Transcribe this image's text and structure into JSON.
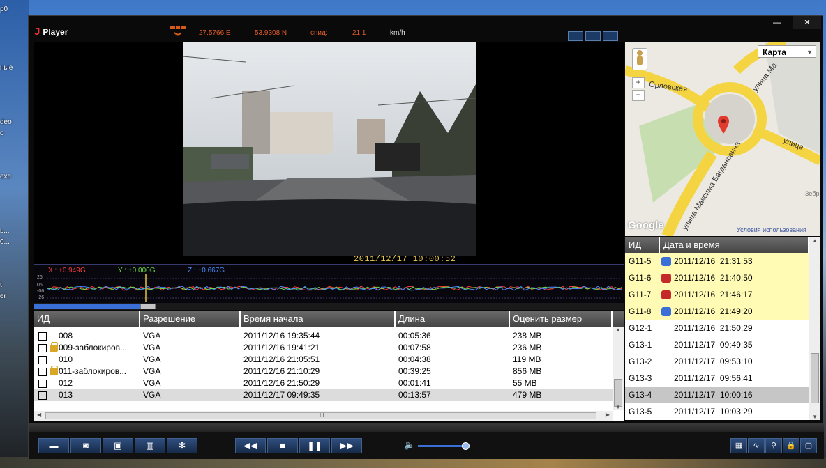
{
  "desktop": {
    "fragments": [
      "p0",
      "ные",
      "deo",
      "o",
      "exe",
      "ь...",
      "0...",
      "t",
      "er"
    ]
  },
  "app": {
    "name": "Player",
    "logo": "J"
  },
  "gps": {
    "longitude": "27.5766 E",
    "latitude": "53.9308 N",
    "speed_label": "спид:",
    "speed": "21.1",
    "unit": "km/h"
  },
  "window_controls": {
    "minimize": "—",
    "close": "✕"
  },
  "video": {
    "timestamp": "2011/12/17   10:00:52"
  },
  "gsensor": {
    "x": "X : +0.949G",
    "y": "Y : +0.000G",
    "z": "Z : +0.667G",
    "ticks": [
      "26",
      "06",
      "-06",
      "-26"
    ],
    "colors": {
      "x": "#ff3b3b",
      "y": "#6fdc4a",
      "z": "#4a8cff"
    }
  },
  "seek": {
    "progress": 0.18
  },
  "file_table": {
    "columns": [
      "ИД",
      "Разрешение",
      "Время начала",
      "Длина",
      "Оценить размер"
    ],
    "rows": [
      {
        "id": "008",
        "locked": false,
        "res": "VGA",
        "start": "2011/12/16 19:35:44",
        "length": "00:05:36",
        "size": "238 MB"
      },
      {
        "id": "009-заблокиров...",
        "locked": true,
        "res": "VGA",
        "start": "2011/12/16 19:41:21",
        "length": "00:07:58",
        "size": "236 MB"
      },
      {
        "id": "010",
        "locked": false,
        "res": "VGA",
        "start": "2011/12/16 21:05:51",
        "length": "00:04:38",
        "size": "119 MB"
      },
      {
        "id": "011-заблокиров...",
        "locked": true,
        "res": "VGA",
        "start": "2011/12/16 21:10:29",
        "length": "00:39:25",
        "size": "856 MB"
      },
      {
        "id": "012",
        "locked": false,
        "res": "VGA",
        "start": "2011/12/16 21:50:29",
        "length": "00:01:41",
        "size": "55 MB"
      },
      {
        "id": "013",
        "locked": false,
        "res": "VGA",
        "start": "2011/12/17 09:49:35",
        "length": "00:13:57",
        "size": "479 MB",
        "selected": true
      }
    ],
    "hscroll_glyph": "III"
  },
  "map": {
    "type_select": "Карта",
    "streets": [
      "Орловская",
      "улица Ма",
      "улица Максима Багдановича",
      "улица",
      "Зебр"
    ],
    "copyright": "Google",
    "terms": "Условия использования",
    "zoom_in": "+",
    "zoom_out": "−"
  },
  "event_table": {
    "columns": [
      "ИД",
      "Дата и время"
    ],
    "rows": [
      {
        "id": "G11-5",
        "date": "2011/12/16",
        "time": "21:31:53",
        "event": "blue"
      },
      {
        "id": "G11-6",
        "date": "2011/12/16",
        "time": "21:40:50",
        "event": "red"
      },
      {
        "id": "G11-7",
        "date": "2011/12/16",
        "time": "21:46:17",
        "event": "red"
      },
      {
        "id": "G11-8",
        "date": "2011/12/16",
        "time": "21:49:20",
        "event": "blue"
      },
      {
        "id": "G12-1",
        "date": "2011/12/16",
        "time": "21:50:29",
        "event": ""
      },
      {
        "id": "G13-1",
        "date": "2011/12/17",
        "time": "09:49:35",
        "event": ""
      },
      {
        "id": "G13-2",
        "date": "2011/12/17",
        "time": "09:53:10",
        "event": ""
      },
      {
        "id": "G13-3",
        "date": "2011/12/17",
        "time": "09:56:41",
        "event": ""
      },
      {
        "id": "G13-4",
        "date": "2011/12/17",
        "time": "10:00:16",
        "event": "",
        "selected": true
      },
      {
        "id": "G13-5",
        "date": "2011/12/17",
        "time": "10:03:29",
        "event": ""
      }
    ]
  },
  "controls": {
    "left": [
      {
        "name": "open-folder-icon",
        "glyph": "▬"
      },
      {
        "name": "snapshot-camera-icon",
        "glyph": "◙"
      },
      {
        "name": "save-disk-icon",
        "glyph": "▣"
      },
      {
        "name": "delete-trash-icon",
        "glyph": "▥"
      },
      {
        "name": "settings-gear-icon",
        "glyph": "✻"
      }
    ],
    "transport": [
      {
        "name": "rewind-icon",
        "glyph": "◀◀"
      },
      {
        "name": "stop-icon",
        "glyph": "■"
      },
      {
        "name": "pause-icon",
        "glyph": "❚❚"
      },
      {
        "name": "fast-forward-icon",
        "glyph": "▶▶"
      }
    ],
    "volume_icon": "🔈",
    "volume": 0.9,
    "right": [
      {
        "name": "map-view-icon",
        "glyph": "▦"
      },
      {
        "name": "graph-wave-icon",
        "glyph": "∿"
      },
      {
        "name": "search-key-icon",
        "glyph": "⚲"
      },
      {
        "name": "lock-icon",
        "glyph": "🔒"
      },
      {
        "name": "window-mode-icon",
        "glyph": "▢"
      }
    ]
  }
}
